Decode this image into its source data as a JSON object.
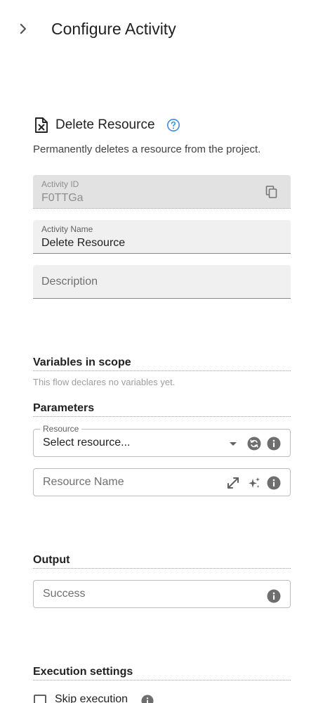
{
  "header": {
    "title": "Configure Activity",
    "collapse_icon": "chevron-right-icon"
  },
  "activity": {
    "icon": "delete-file-icon",
    "title": "Delete Resource",
    "help_icon": "help-circle-icon",
    "description": "Permanently deletes a resource from the project."
  },
  "fields": {
    "activity_id": {
      "label": "Activity ID",
      "value": "F0TTGa",
      "copy_icon": "copy-icon"
    },
    "activity_name": {
      "label": "Activity Name",
      "value": "Delete Resource"
    },
    "description": {
      "placeholder": "Description"
    }
  },
  "variables": {
    "title": "Variables in scope",
    "empty_text": "This flow declares no variables yet."
  },
  "parameters": {
    "title": "Parameters",
    "resource": {
      "label": "Resource",
      "value": "Select resource...",
      "icons": [
        "dropdown-arrow-icon",
        "refresh-icon",
        "info-icon"
      ]
    },
    "resource_name": {
      "placeholder": "Resource Name",
      "icons": [
        "expand-icon",
        "sparkle-icon",
        "info-icon"
      ]
    }
  },
  "output": {
    "title": "Output",
    "success": {
      "placeholder": "Success",
      "icon": "info-icon"
    }
  },
  "execution": {
    "title": "Execution settings",
    "skip_label": "Skip execution",
    "skip_checked": false
  }
}
